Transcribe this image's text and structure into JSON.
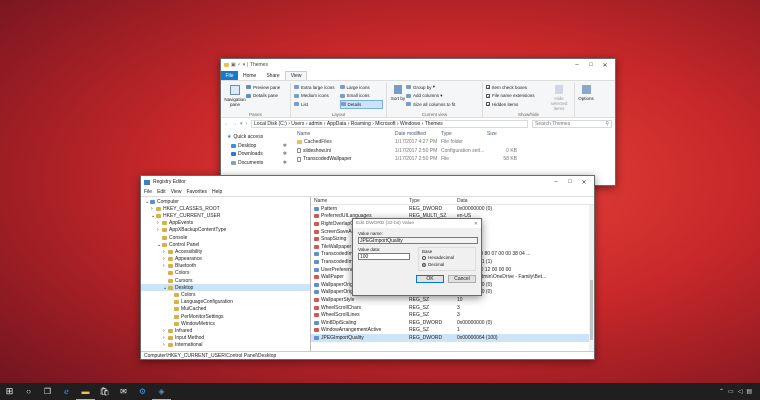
{
  "explorer": {
    "title": "Themes",
    "tabs": [
      "File",
      "Home",
      "Share",
      "View"
    ],
    "ribbon": {
      "panes": {
        "navigation_pane": "Navigation pane",
        "preview_pane": "Preview pane",
        "details_pane": "Details pane",
        "group_label": "Panes"
      },
      "layout": {
        "items": [
          "Extra large icons",
          "Large icons",
          "Medium icons",
          "Small icons",
          "List",
          "Details"
        ],
        "group_label": "Layout"
      },
      "current_view": {
        "sort_by": "Sort by",
        "group_by": "Group by",
        "add_columns": "Add columns",
        "size_columns": "Size all columns to fit",
        "group_label": "Current view"
      },
      "show_hide": {
        "item_check_boxes": "Item check boxes",
        "file_name_extensions": "File name extensions",
        "hidden_items": "Hidden items",
        "hide_selected": "Hide selected items",
        "group_label": "Show/hide"
      },
      "options": "Options"
    },
    "breadcrumb": [
      "Local Disk (C:)",
      "Users",
      "admin",
      "AppData",
      "Roaming",
      "Microsoft",
      "Windows",
      "Themes"
    ],
    "search_placeholder": "Search Themes",
    "quick_access": {
      "header": "Quick access",
      "items": [
        "Desktop",
        "Downloads",
        "Documents"
      ]
    },
    "columns": [
      "Name",
      "Date modified",
      "Type",
      "Size"
    ],
    "files": [
      {
        "name": "CachedFiles",
        "date": "1/17/2017 4:27 PM",
        "type": "File folder",
        "size": ""
      },
      {
        "name": "slideshow.ini",
        "date": "1/17/2017 2:50 PM",
        "type": "Configuration sett...",
        "size": "0 KB"
      },
      {
        "name": "TranscodedWallpaper",
        "date": "1/17/2017 2:50 PM",
        "type": "File",
        "size": "58 KB"
      }
    ]
  },
  "regedit": {
    "title": "Registry Editor",
    "menu": [
      "File",
      "Edit",
      "View",
      "Favorites",
      "Help"
    ],
    "tree": [
      {
        "label": "Computer",
        "level": 0
      },
      {
        "label": "HKEY_CLASSES_ROOT",
        "level": 1
      },
      {
        "label": "HKEY_CURRENT_USER",
        "level": 1
      },
      {
        "label": "AppEvents",
        "level": 2
      },
      {
        "label": "AppXBackupContentType",
        "level": 2
      },
      {
        "label": "Console",
        "level": 2
      },
      {
        "label": "Control Panel",
        "level": 2
      },
      {
        "label": "Accessibility",
        "level": 3
      },
      {
        "label": "Appearance",
        "level": 3
      },
      {
        "label": "Bluetooth",
        "level": 3
      },
      {
        "label": "Colors",
        "level": 3
      },
      {
        "label": "Cursors",
        "level": 3
      },
      {
        "label": "Desktop",
        "level": 3,
        "selected": true
      },
      {
        "label": "Colors",
        "level": 4
      },
      {
        "label": "LanguageConfiguration",
        "level": 4
      },
      {
        "label": "MuiCached",
        "level": 4
      },
      {
        "label": "PerMonitorSettings",
        "level": 4
      },
      {
        "label": "WindowMetrics",
        "level": 4
      },
      {
        "label": "Infrared",
        "level": 3
      },
      {
        "label": "Input Method",
        "level": 3
      },
      {
        "label": "International",
        "level": 3
      }
    ],
    "columns": [
      "Name",
      "Type",
      "Data"
    ],
    "values": [
      {
        "name": "Pattern",
        "type": "REG_DWORD",
        "data": "0x00000000 (0)"
      },
      {
        "name": "PreferredUILanguages",
        "type": "REG_MULTI_SZ",
        "data": "en-US"
      },
      {
        "name": "RightOverlapChars",
        "type": "REG_SZ",
        "data": "3"
      },
      {
        "name": "ScreenSaveActive",
        "type": "REG_SZ",
        "data": "1"
      },
      {
        "name": "SnapSizing",
        "type": "REG_SZ",
        "data": "1"
      },
      {
        "name": "TileWallpaper",
        "type": "REG_SZ",
        "data": "0"
      },
      {
        "name": "TranscodedImageCache",
        "type": "REG_BINARY",
        "data": "7a c3 01 00 80 07 00 00 38 04 ..."
      },
      {
        "name": "TranscodedImageCount",
        "type": "REG_DWORD",
        "data": "0x00000001 (1)"
      },
      {
        "name": "UserPreferencesMask",
        "type": "REG_BINARY",
        "data": "9e 1e 07 80 12 00 00 00"
      },
      {
        "name": "WallPaper",
        "type": "REG_SZ",
        "data": "C:\\Users\\admin\\OneDrive - Family\\Bet..."
      },
      {
        "name": "WallpaperOriginX",
        "type": "REG_DWORD",
        "data": "0x00000000 (0)"
      },
      {
        "name": "WallpaperOriginY",
        "type": "REG_DWORD",
        "data": "0x00000000 (0)"
      },
      {
        "name": "WallpaperStyle",
        "type": "REG_SZ",
        "data": "10"
      },
      {
        "name": "WheelScrollChars",
        "type": "REG_SZ",
        "data": "3"
      },
      {
        "name": "WheelScrollLines",
        "type": "REG_SZ",
        "data": "3"
      },
      {
        "name": "Win8DpiScaling",
        "type": "REG_DWORD",
        "data": "0x00000000 (0)"
      },
      {
        "name": "WindowArrangementActive",
        "type": "REG_SZ",
        "data": "1"
      },
      {
        "name": "JPEGImportQuality",
        "type": "REG_DWORD",
        "data": "0x00000064 (100)",
        "selected": true
      }
    ],
    "status_path": "Computer\\HKEY_CURRENT_USER\\Control Panel\\Desktop"
  },
  "dialog": {
    "title": "Edit DWORD (32-bit) Value",
    "value_name_label": "Value name:",
    "value_name": "JPEGImportQuality",
    "value_data_label": "Value data:",
    "value_data": "100",
    "base_label": "Base",
    "hex_label": "Hexadecimal",
    "dec_label": "Decimal",
    "ok": "OK",
    "cancel": "Cancel"
  },
  "colors": {
    "accent": "#0078d7",
    "taskbar": "#1f1f1f",
    "selection": "#cce4f7"
  }
}
